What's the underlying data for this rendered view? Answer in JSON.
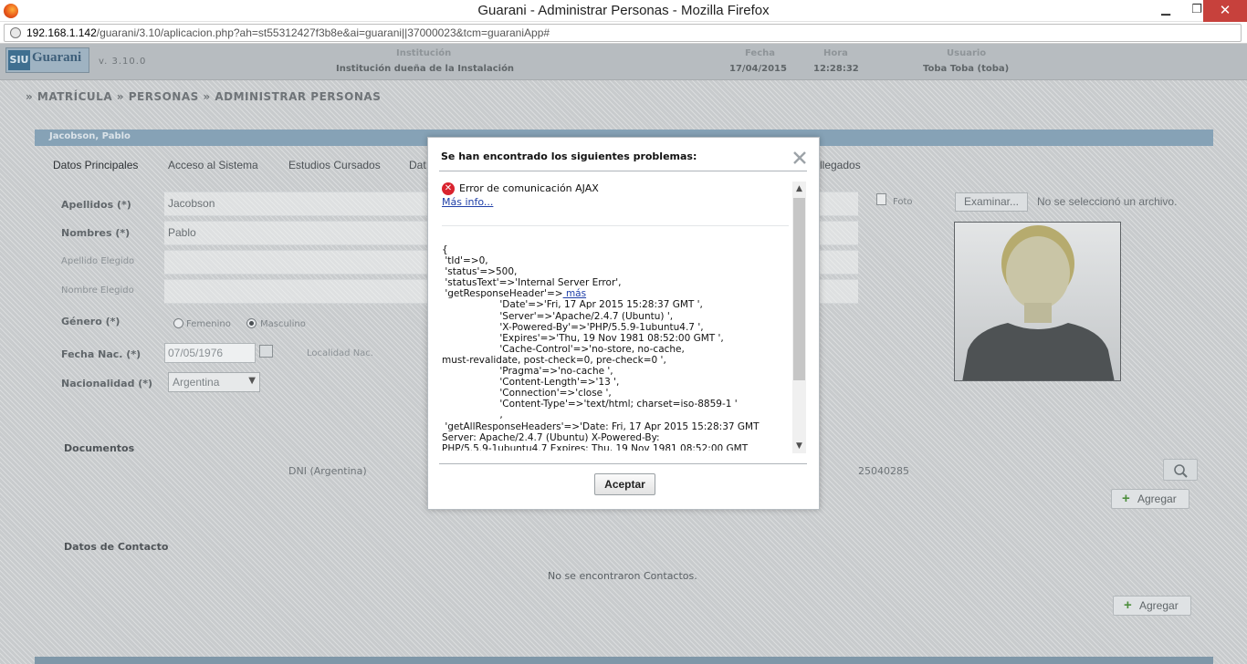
{
  "window": {
    "title": "Guarani - Administrar Personas - Mozilla Firefox",
    "minimize_label": "▁",
    "maximize_label": "❐",
    "close_label": "✕"
  },
  "urlbar": {
    "host": "192.168.1.142",
    "path": "/guarani/3.10/aplicacion.php?ah=st55312427f3b8e&ai=guarani||37000023&tcm=guaraniApp#"
  },
  "app_header": {
    "logo_siu": "SIU",
    "logo_name": "Guarani",
    "version": "v. 3.10.0",
    "institucion_label": "Institución",
    "institucion_value": "Institución dueña de la Instalación",
    "fecha_label": "Fecha",
    "fecha_value": "17/04/2015",
    "hora_label": "Hora",
    "hora_value": "12:28:32",
    "usuario_label": "Usuario",
    "usuario_value": "Toba Toba (toba)"
  },
  "breadcrumb": "» MATRÍCULA » PERSONAS » ADMINISTRAR PERSONAS",
  "panel_title": "Jacobson, Pablo",
  "tabs": [
    "Datos Principales",
    "Acceso al Sistema",
    "Estudios Cursados",
    "Dat",
    "llegados"
  ],
  "form": {
    "apellidos_label": "Apellidos (*)",
    "apellidos_value": "Jacobson",
    "nombres_label": "Nombres (*)",
    "nombres_value": "Pablo",
    "apellido_elegido_label": "Apellido Elegido",
    "nombre_elegido_label": "Nombre Elegido",
    "genero_label": "Género (*)",
    "genero_options": [
      "Femenino",
      "Masculino"
    ],
    "genero_selected": "Masculino",
    "fecha_nac_label": "Fecha Nac. (*)",
    "fecha_nac_value": "07/05/1976",
    "localidad_label": "Localidad Nac.",
    "nacionalidad_label": "Nacionalidad (*)",
    "nacionalidad_value": "Argentina",
    "foto_label": "Foto",
    "browse_label": "Examinar...",
    "no_file_label": "No se seleccionó un archivo."
  },
  "documentos": {
    "title": "Documentos",
    "tipo": "DNI (Argentina)",
    "numero": "25040285",
    "add_label": "Agregar"
  },
  "contacto": {
    "title": "Datos de Contacto",
    "empty": "No se encontraron Contactos.",
    "add_label": "Agregar"
  },
  "modal": {
    "title": "Se han encontrado los siguientes problemas:",
    "error_text": "Error de comunicación AJAX",
    "more_info": "Más info...",
    "detail_pre": "{\n 'tId'=>0,\n 'status'=>500,\n 'statusText'=>'Internal Server Error',\n 'getResponseHeader'=>",
    "detail_link": " más",
    "detail_post": "\n                   'Date'=>'Fri, 17 Apr 2015 15:28:37 GMT ',\n                   'Server'=>'Apache/2.4.7 (Ubuntu) ',\n                   'X-Powered-By'=>'PHP/5.5.9-1ubuntu4.7 ',\n                   'Expires'=>'Thu, 19 Nov 1981 08:52:00 GMT ',\n                   'Cache-Control'=>'no-store, no-cache,\nmust-revalidate, post-check=0, pre-check=0 ',\n                   'Pragma'=>'no-cache ',\n                   'Content-Length'=>'13 ',\n                   'Connection'=>'close ',\n                   'Content-Type'=>'text/html; charset=iso-8859-1 '\n                   ,\n 'getAllResponseHeaders'=>'Date: Fri, 17 Apr 2015 15:28:37 GMT\nServer: Apache/2.4.7 (Ubuntu) X-Powered-By:\nPHP/5.5.9-1ubuntu4.7 Expires: Thu, 19 Nov 1981 08:52:00 GMT",
    "accept_label": "Aceptar",
    "scroll_up": "▲",
    "scroll_down": "▼"
  },
  "colors": {
    "accent_bar": "#86a2b6",
    "error_red": "#d9232e",
    "link_blue": "#1f3fa8",
    "add_green": "#4e8f3e"
  }
}
